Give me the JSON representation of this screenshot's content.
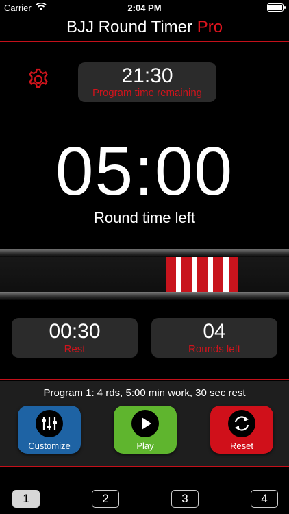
{
  "status_bar": {
    "carrier": "Carrier",
    "time": "2:04 PM"
  },
  "header": {
    "title_main": "BJJ Round Timer",
    "title_accent": "Pro",
    "accent_color": "#e0141e"
  },
  "program_remaining": {
    "time": "21:30",
    "label": "Program time remaining"
  },
  "round": {
    "time": "05:00",
    "label": "Round time left"
  },
  "belt": {
    "stripes": 4,
    "bar_color": "#c8141d"
  },
  "rest": {
    "value": "00:30",
    "label": "Rest"
  },
  "rounds_left": {
    "value": "04",
    "label": "Rounds left"
  },
  "program_info": "Program 1: 4 rds, 5:00 min work, 30 sec rest",
  "buttons": {
    "customize": {
      "label": "Customize",
      "color": "#1e63a4",
      "icon": "sliders-icon"
    },
    "play": {
      "label": "Play",
      "color": "#5fb52e",
      "icon": "play-icon"
    },
    "reset": {
      "label": "Reset",
      "color": "#d0101a",
      "icon": "refresh-icon"
    }
  },
  "pages": [
    {
      "label": "1",
      "selected": true
    },
    {
      "label": "2",
      "selected": false
    },
    {
      "label": "3",
      "selected": false
    },
    {
      "label": "4",
      "selected": false
    }
  ]
}
